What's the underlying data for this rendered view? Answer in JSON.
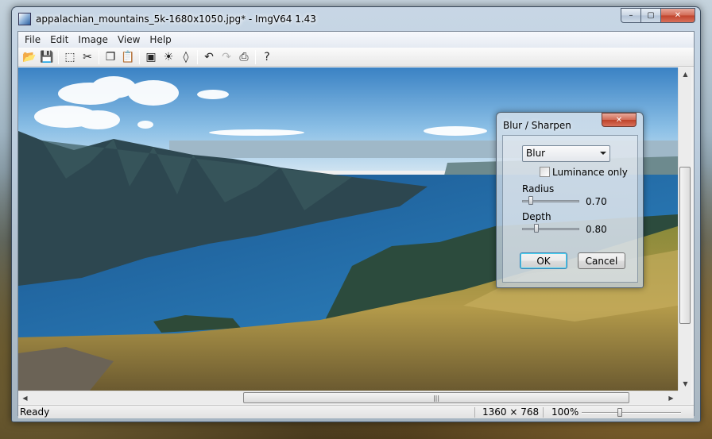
{
  "window": {
    "title": "appalachian_mountains_5k-1680x1050.jpg* - ImgV64 1.43",
    "minimize_glyph": "–",
    "maximize_glyph": "▢",
    "close_glyph": "✕"
  },
  "menu": [
    "File",
    "Edit",
    "Image",
    "View",
    "Help"
  ],
  "toolbar": {
    "buttons": [
      {
        "name": "open-icon",
        "glyph": "📂"
      },
      {
        "name": "save-icon",
        "glyph": "💾"
      },
      {
        "name": "select-icon",
        "glyph": "⬚"
      },
      {
        "name": "crop-icon",
        "glyph": "✂"
      },
      {
        "name": "copy-icon",
        "glyph": "❐"
      },
      {
        "name": "paste-icon",
        "glyph": "📋"
      },
      {
        "name": "resize-icon",
        "glyph": "▣"
      },
      {
        "name": "brightness-icon",
        "glyph": "☀"
      },
      {
        "name": "blur-drop-icon",
        "glyph": "◊"
      },
      {
        "name": "undo-icon",
        "glyph": "↶"
      },
      {
        "name": "redo-icon",
        "glyph": "↷"
      },
      {
        "name": "print-icon",
        "glyph": "⎙"
      },
      {
        "name": "help-icon",
        "glyph": "?"
      }
    ]
  },
  "status": {
    "ready": "Ready",
    "dimensions": "1360 × 768",
    "zoom": "100%",
    "zoom_slider_value": 0.38
  },
  "dialog": {
    "title": "Blur / Sharpen",
    "close_glyph": "✕",
    "mode": "Blur",
    "luminance_only_label": "Luminance only",
    "luminance_only_checked": false,
    "radius_label": "Radius",
    "radius_value": "0.70",
    "depth_label": "Depth",
    "depth_value": "0.80",
    "ok_label": "OK",
    "cancel_label": "Cancel"
  },
  "scroll": {
    "grip": "|||"
  },
  "colors": {
    "sky_top": "#3f86c6",
    "lake": "#1f5f9c",
    "mountain": "#2f4a52",
    "grass": "#a8953f"
  }
}
